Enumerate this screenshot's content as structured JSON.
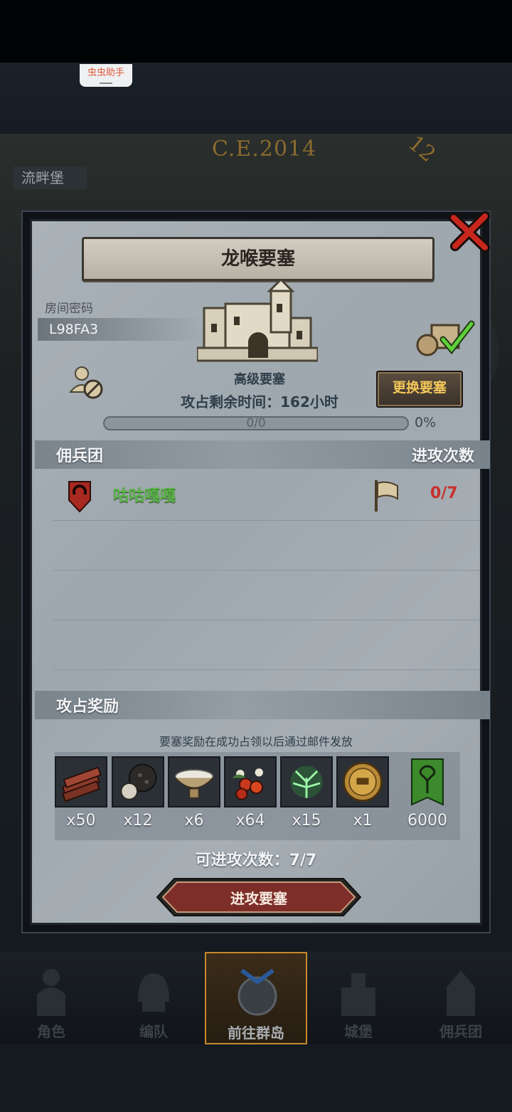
{
  "status_overlay": {
    "helper_tag": "虫虫助手"
  },
  "background": {
    "era_label": "C.E.2014",
    "clock_number": "12",
    "castle_tag": "流畔堡"
  },
  "fortress": {
    "title": "龙喉要塞",
    "room_password_label": "房间密码",
    "room_password": "L98FA3",
    "fortress_type": "高级要塞",
    "time_remaining": "攻占剩余时间：162小时",
    "change_button": "更换要塞",
    "progress_text": "0/0",
    "progress_percent": "0%",
    "progress_fraction": 0
  },
  "mercenary": {
    "header_left": "佣兵团",
    "header_right": "进攻次数",
    "rows": [
      {
        "name": "咕咕嘎嘎",
        "count": "0/7"
      }
    ]
  },
  "rewards": {
    "header": "攻占奖励",
    "note": "要塞奖励在成功占领以后通过邮件发放",
    "items": [
      {
        "icon": "wood-planks-icon",
        "count": "x50"
      },
      {
        "icon": "truffle-icon",
        "count": "x12"
      },
      {
        "icon": "milk-bowl-icon",
        "count": "x6"
      },
      {
        "icon": "berries-icon",
        "count": "x64"
      },
      {
        "icon": "green-herb-icon",
        "count": "x15"
      },
      {
        "icon": "knight-medal-icon",
        "count": "x1"
      },
      {
        "icon": "tree-banner-icon",
        "count": "6000"
      }
    ],
    "available_attacks": "可进攻次数：7/7",
    "attack_button": "进攻要塞"
  },
  "bottom_nav": [
    {
      "label": "角色",
      "icon": "knight-icon"
    },
    {
      "label": "编队",
      "icon": "helmet-icon"
    },
    {
      "label": "前往群岛",
      "icon": "world-map-icon",
      "active": true
    },
    {
      "label": "城堡",
      "icon": "castle-icon"
    },
    {
      "label": "佣兵团",
      "icon": "mercenary-icon"
    }
  ],
  "colors": {
    "guild_green": "#5ab548",
    "count_red": "#c9302b",
    "button_gold": "#f3c75a"
  }
}
